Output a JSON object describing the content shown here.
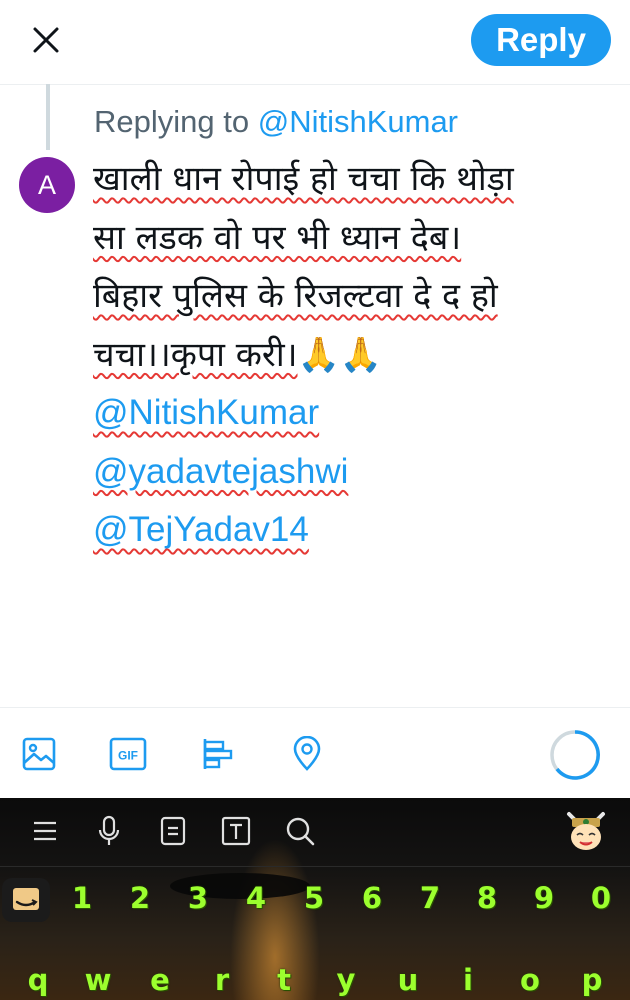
{
  "header": {
    "reply_label": "Reply"
  },
  "compose": {
    "replying_prefix": "Replying to",
    "replying_handle": "@NitishKumar",
    "avatar_initial": "A",
    "lines": [
      "खाली धान रोपाई हो चचा कि थोड़ा",
      "सा लडक वो पर भी ध्यान देब।",
      "बिहार पुलिस के रिजल्टवा दे द हो",
      "चचा।।कृपा करी।"
    ],
    "emoji": "🙏🙏",
    "mentions": [
      "@NitishKumar",
      "@yadavtejashwi",
      "@TejYadav14"
    ]
  },
  "toolbar": {
    "icons": [
      "image-icon",
      "gif-icon",
      "poll-icon",
      "location-icon",
      "character-progress-ring"
    ],
    "gif_label": "GIF",
    "accent_color": "#1d9bf0"
  },
  "keyboard": {
    "number_row": [
      "1",
      "2",
      "3",
      "4",
      "5",
      "6",
      "7",
      "8",
      "9",
      "0"
    ],
    "letter_row": [
      "q",
      "w",
      "e",
      "r",
      "t",
      "y",
      "u",
      "i",
      "o",
      "p"
    ],
    "key_color": "#9cff2e"
  }
}
